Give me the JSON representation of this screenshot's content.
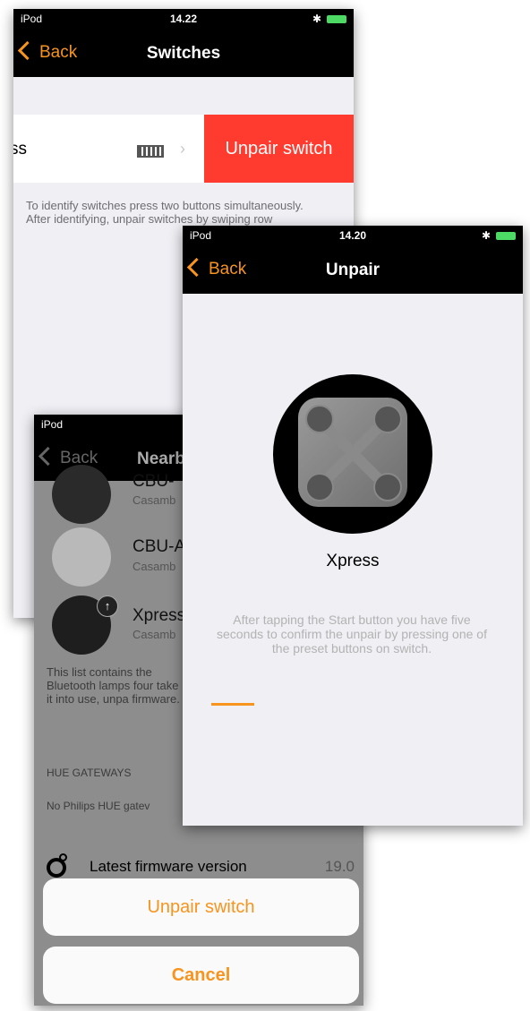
{
  "screen1": {
    "status": {
      "carrier": "iPod",
      "time": "14.22"
    },
    "nav": {
      "back": "Back",
      "title": "Switches"
    },
    "row": {
      "name_partial": "ss",
      "action": "Unpair switch"
    },
    "hint": "To identify switches press two buttons simultaneously. After identifying, unpair switches by swiping row"
  },
  "screen3": {
    "status": {
      "carrier": "iPod"
    },
    "nav": {
      "back": "Back",
      "title": "Nearb"
    },
    "devices": [
      {
        "name": "CBU-",
        "sub": "Casamb"
      },
      {
        "name": "CBU-A",
        "sub": "Casamb"
      },
      {
        "name": "Xpress",
        "sub": "Casamb"
      }
    ],
    "info": "This list contains the Bluetooth lamps four take it into use, unpa firmware.",
    "section_header": "HUE GATEWAYS",
    "no_gateways": "No Philips HUE gatev",
    "firmware": {
      "label": "Latest firmware version",
      "value": "19.0"
    },
    "sheet": {
      "unpair": "Unpair switch",
      "cancel": "Cancel"
    }
  },
  "screen2": {
    "status": {
      "carrier": "iPod",
      "time": "14.20"
    },
    "nav": {
      "back": "Back",
      "title": "Unpair"
    },
    "device_name": "Xpress",
    "instruction": "After tapping the Start button you have five seconds to confirm the unpair by pressing one of the preset buttons on switch.",
    "progress": 0.15,
    "accent": "#f7941d"
  }
}
